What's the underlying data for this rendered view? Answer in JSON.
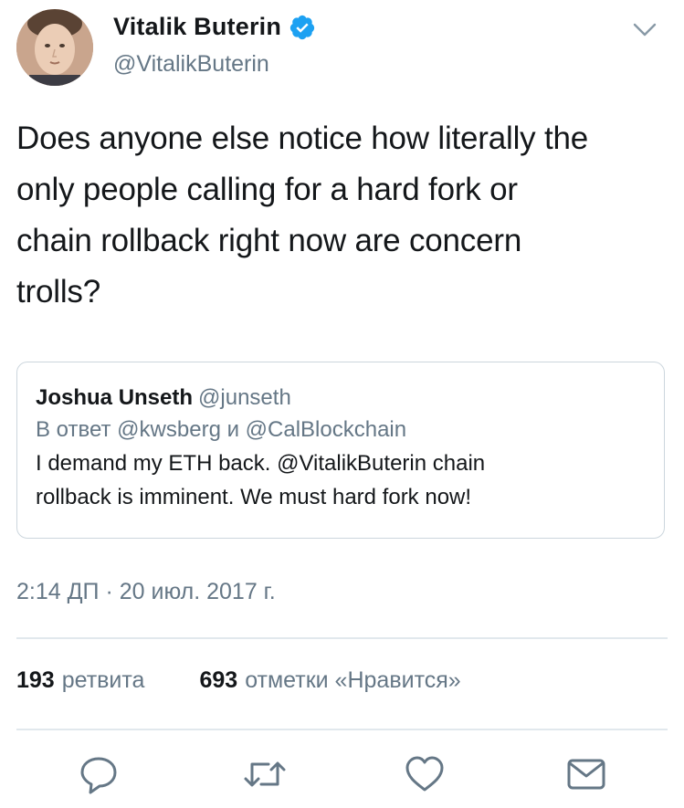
{
  "tweet": {
    "author": {
      "name": "Vitalik Buterin",
      "handle": "@VitalikButerin",
      "verified_icon": "verified-badge-icon",
      "avatar_icon": "avatar-photo"
    },
    "menu_icon": "chevron-down-icon",
    "text": "Does anyone else notice how literally the\nonly people calling for a hard fork or\nchain rollback right now are concern\ntrolls?",
    "quoted": {
      "name": "Joshua Unseth",
      "handle": "@junseth",
      "reply_line": "В ответ @kwsberg и @CalBlockchain",
      "text": "I demand my ETH back. @VitalikButerin chain\nrollback is imminent. We must hard fork now!"
    },
    "timestamp": "2:14 ДП · 20 июл. 2017 г.",
    "stats": {
      "retweets_count": "193",
      "retweets_label": "ретвита",
      "likes_count": "693",
      "likes_label": "отметки «Нравится»"
    },
    "actions": [
      "reply-icon",
      "retweet-icon",
      "like-icon",
      "message-icon"
    ]
  },
  "colors": {
    "text": "#14171a",
    "secondary": "#657786",
    "border": "#ccd6dd",
    "divider": "#e1e8ed",
    "verified": "#1da1f2"
  }
}
